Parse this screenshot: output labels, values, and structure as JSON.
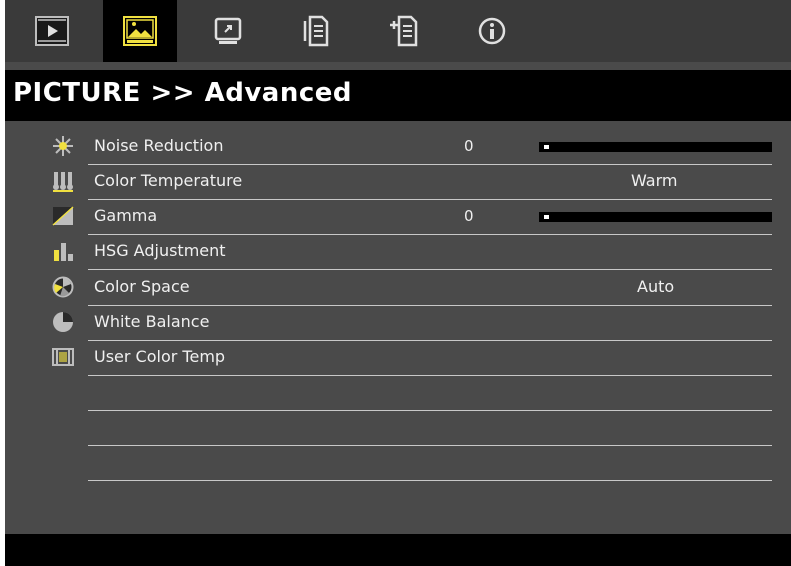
{
  "tabs": [
    {
      "name": "tab-display",
      "icon": "display-input-icon",
      "active": false
    },
    {
      "name": "tab-picture",
      "icon": "picture-icon",
      "active": true
    },
    {
      "name": "tab-setting",
      "icon": "screen-setting-icon",
      "active": false
    },
    {
      "name": "tab-options",
      "icon": "document-options-icon",
      "active": false
    },
    {
      "name": "tab-options-advanced",
      "icon": "document-plus-icon",
      "active": false
    },
    {
      "name": "tab-information",
      "icon": "info-circle-icon",
      "active": false
    }
  ],
  "header": {
    "title": "PICTURE >> Advanced"
  },
  "menu": {
    "items": [
      {
        "label": "Noise Reduction",
        "icon": "noise-reduction-icon",
        "number": "0",
        "slider_fraction": 0.0
      },
      {
        "label": "Color Temperature",
        "icon": "color-temperature-icon",
        "value": "Warm"
      },
      {
        "label": "Gamma",
        "icon": "gamma-icon",
        "number": "0",
        "slider_fraction": 0.0
      },
      {
        "label": "HSG Adjustment",
        "icon": "hsg-adjustment-icon"
      },
      {
        "label": "Color Space",
        "icon": "color-space-icon",
        "value": "Auto"
      },
      {
        "label": "White Balance",
        "icon": "white-balance-icon"
      },
      {
        "label": "User Color Temp",
        "icon": "user-color-temp-icon"
      }
    ]
  },
  "colors": {
    "background": "#4a4a4a",
    "tabbar": "#3a3a3a",
    "active_tab": "#000000",
    "title_bar": "#000000",
    "text": "#f0f0f0",
    "divider": "#c8c8c8",
    "icon_yellow": "#f0e040"
  }
}
